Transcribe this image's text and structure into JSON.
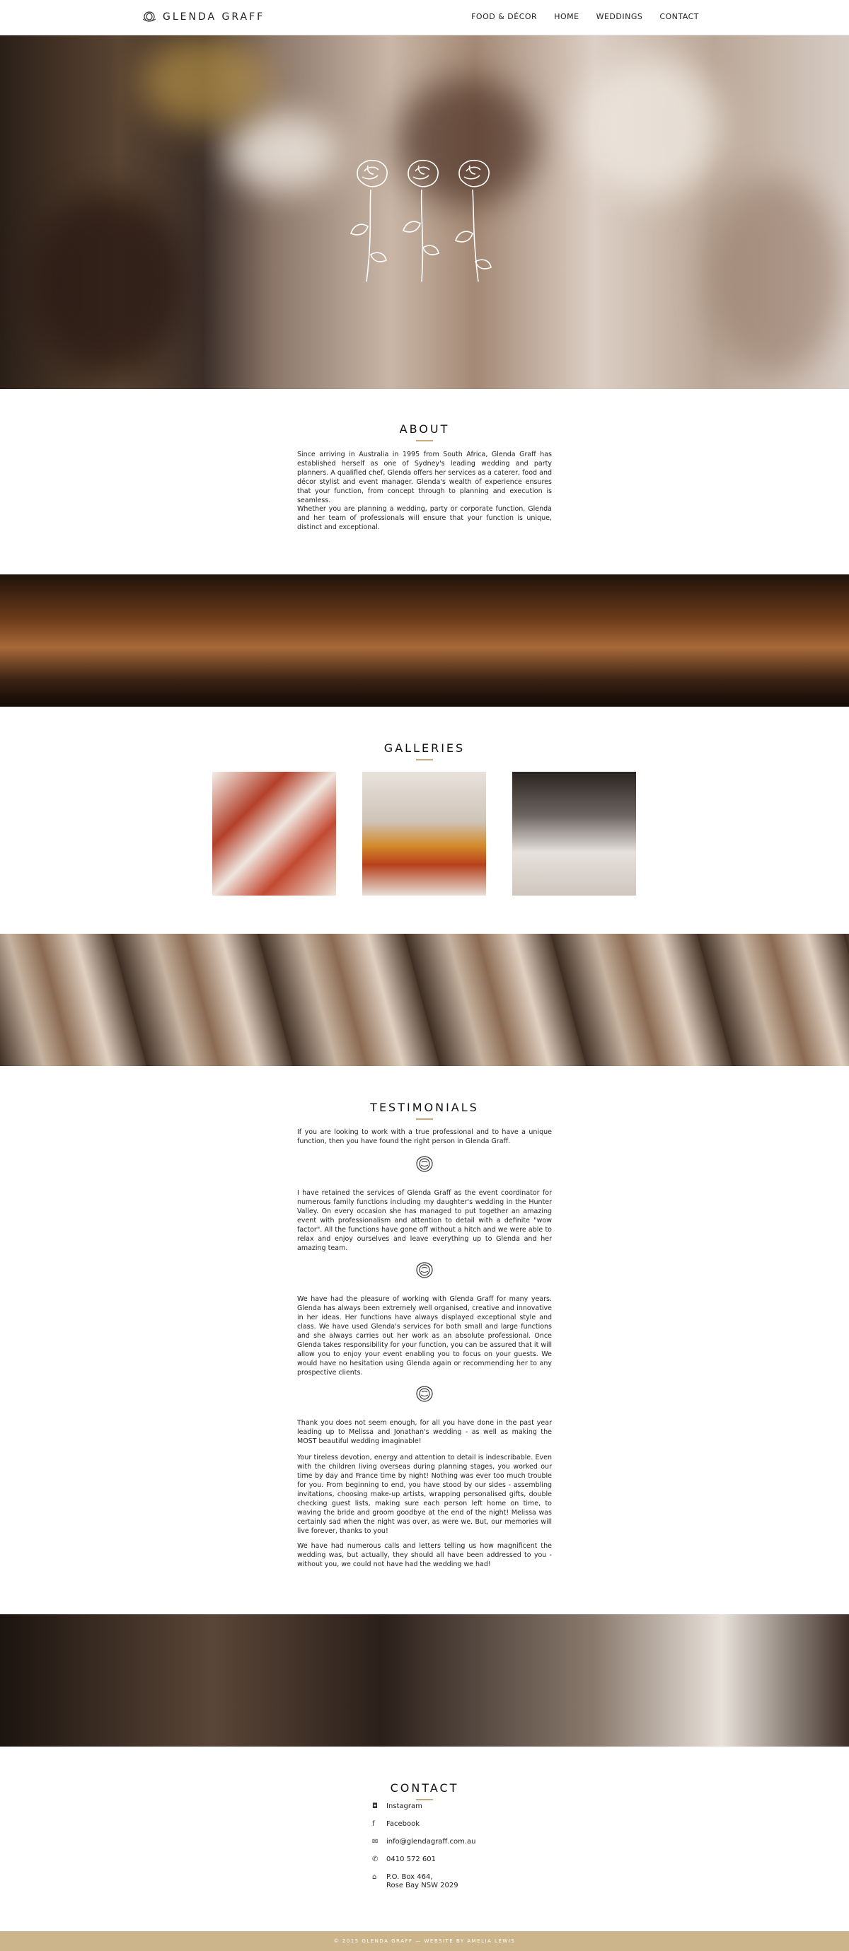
{
  "nav": {
    "brand": "GLENDA GRAFF",
    "items": [
      "FOOD & DÉCOR",
      "HOME",
      "WEDDINGS",
      "CONTACT"
    ]
  },
  "about": {
    "title": "ABOUT",
    "p1": "Since arriving in Australia in 1995 from South Africa, Glenda Graff has established herself as one of Sydney's leading wedding and party planners. A qualified chef, Glenda offers her services as a caterer, food and décor stylist and event manager. Glenda's wealth of experience ensures that your function, from concept through to planning and execution is seamless.",
    "p2": "Whether you are planning a wedding, party or corporate function, Glenda and her team of professionals will ensure that your function is unique, distinct and exceptional."
  },
  "galleries": {
    "title": "GALLERIES"
  },
  "testimonials": {
    "title": "TESTIMONIALS",
    "intro": "If you are looking to work with a true professional and to have a unique function, then you have found the right person in Glenda Graff.",
    "t1": "I have retained the services of Glenda Graff as the event coordinator for numerous family functions including my daughter's wedding in the Hunter Valley. On every occasion she has managed to put together an amazing event with professionalism and attention to detail with a definite \"wow factor\". All the functions have gone off without a hitch and we were able to relax and enjoy ourselves and leave everything up to Glenda and her amazing team.",
    "t2": "We have had the pleasure of working with Glenda Graff for many years. Glenda has always been extremely well organised, creative and innovative in her ideas. Her functions have always displayed exceptional style and class. We have used Glenda's services for both small and large functions and she always carries out her work as an absolute professional. Once Glenda takes responsibility for your function, you can be assured that it will allow you to enjoy your event enabling you to focus on your guests. We would have no hesitation using Glenda again or recommending her to any prospective clients.",
    "t3a": "Thank you does not seem enough, for all you have done in the past year leading up to Melissa and Jonathan's wedding - as well as making the MOST beautiful wedding imaginable!",
    "t3b": "Your tireless devotion, energy and attention to detail is indescribable. Even with the children living overseas during planning stages, you worked our time by day and France time by night! Nothing was ever too much trouble for you. From beginning to end, you have stood by our sides - assembling invitations, choosing make-up artists, wrapping personalised gifts, double checking guest lists, making sure each person left home on time, to waving the bride and groom goodbye at the end of the night! Melissa was certainly sad when the night was over, as were we. But, our memories will live forever, thanks to you!",
    "t3c": "We have had numerous calls and letters telling us how magnificent the wedding was, but actually, they should all have been addressed to you - without you, we could not have had the wedding we had!"
  },
  "contact": {
    "title": "CONTACT",
    "instagram": "Instagram",
    "facebook": "Facebook",
    "email": "info@glendagraff.com.au",
    "phone": "0410 572 601",
    "address": "P.O. Box 464,\nRose Bay NSW 2029"
  },
  "footer": {
    "text": "© 2015 GLENDA GRAFF — WEBSITE BY AMELIA LEWIS"
  },
  "colors": {
    "accent": "#c9a97a",
    "footer_bg": "#cdb58b"
  }
}
